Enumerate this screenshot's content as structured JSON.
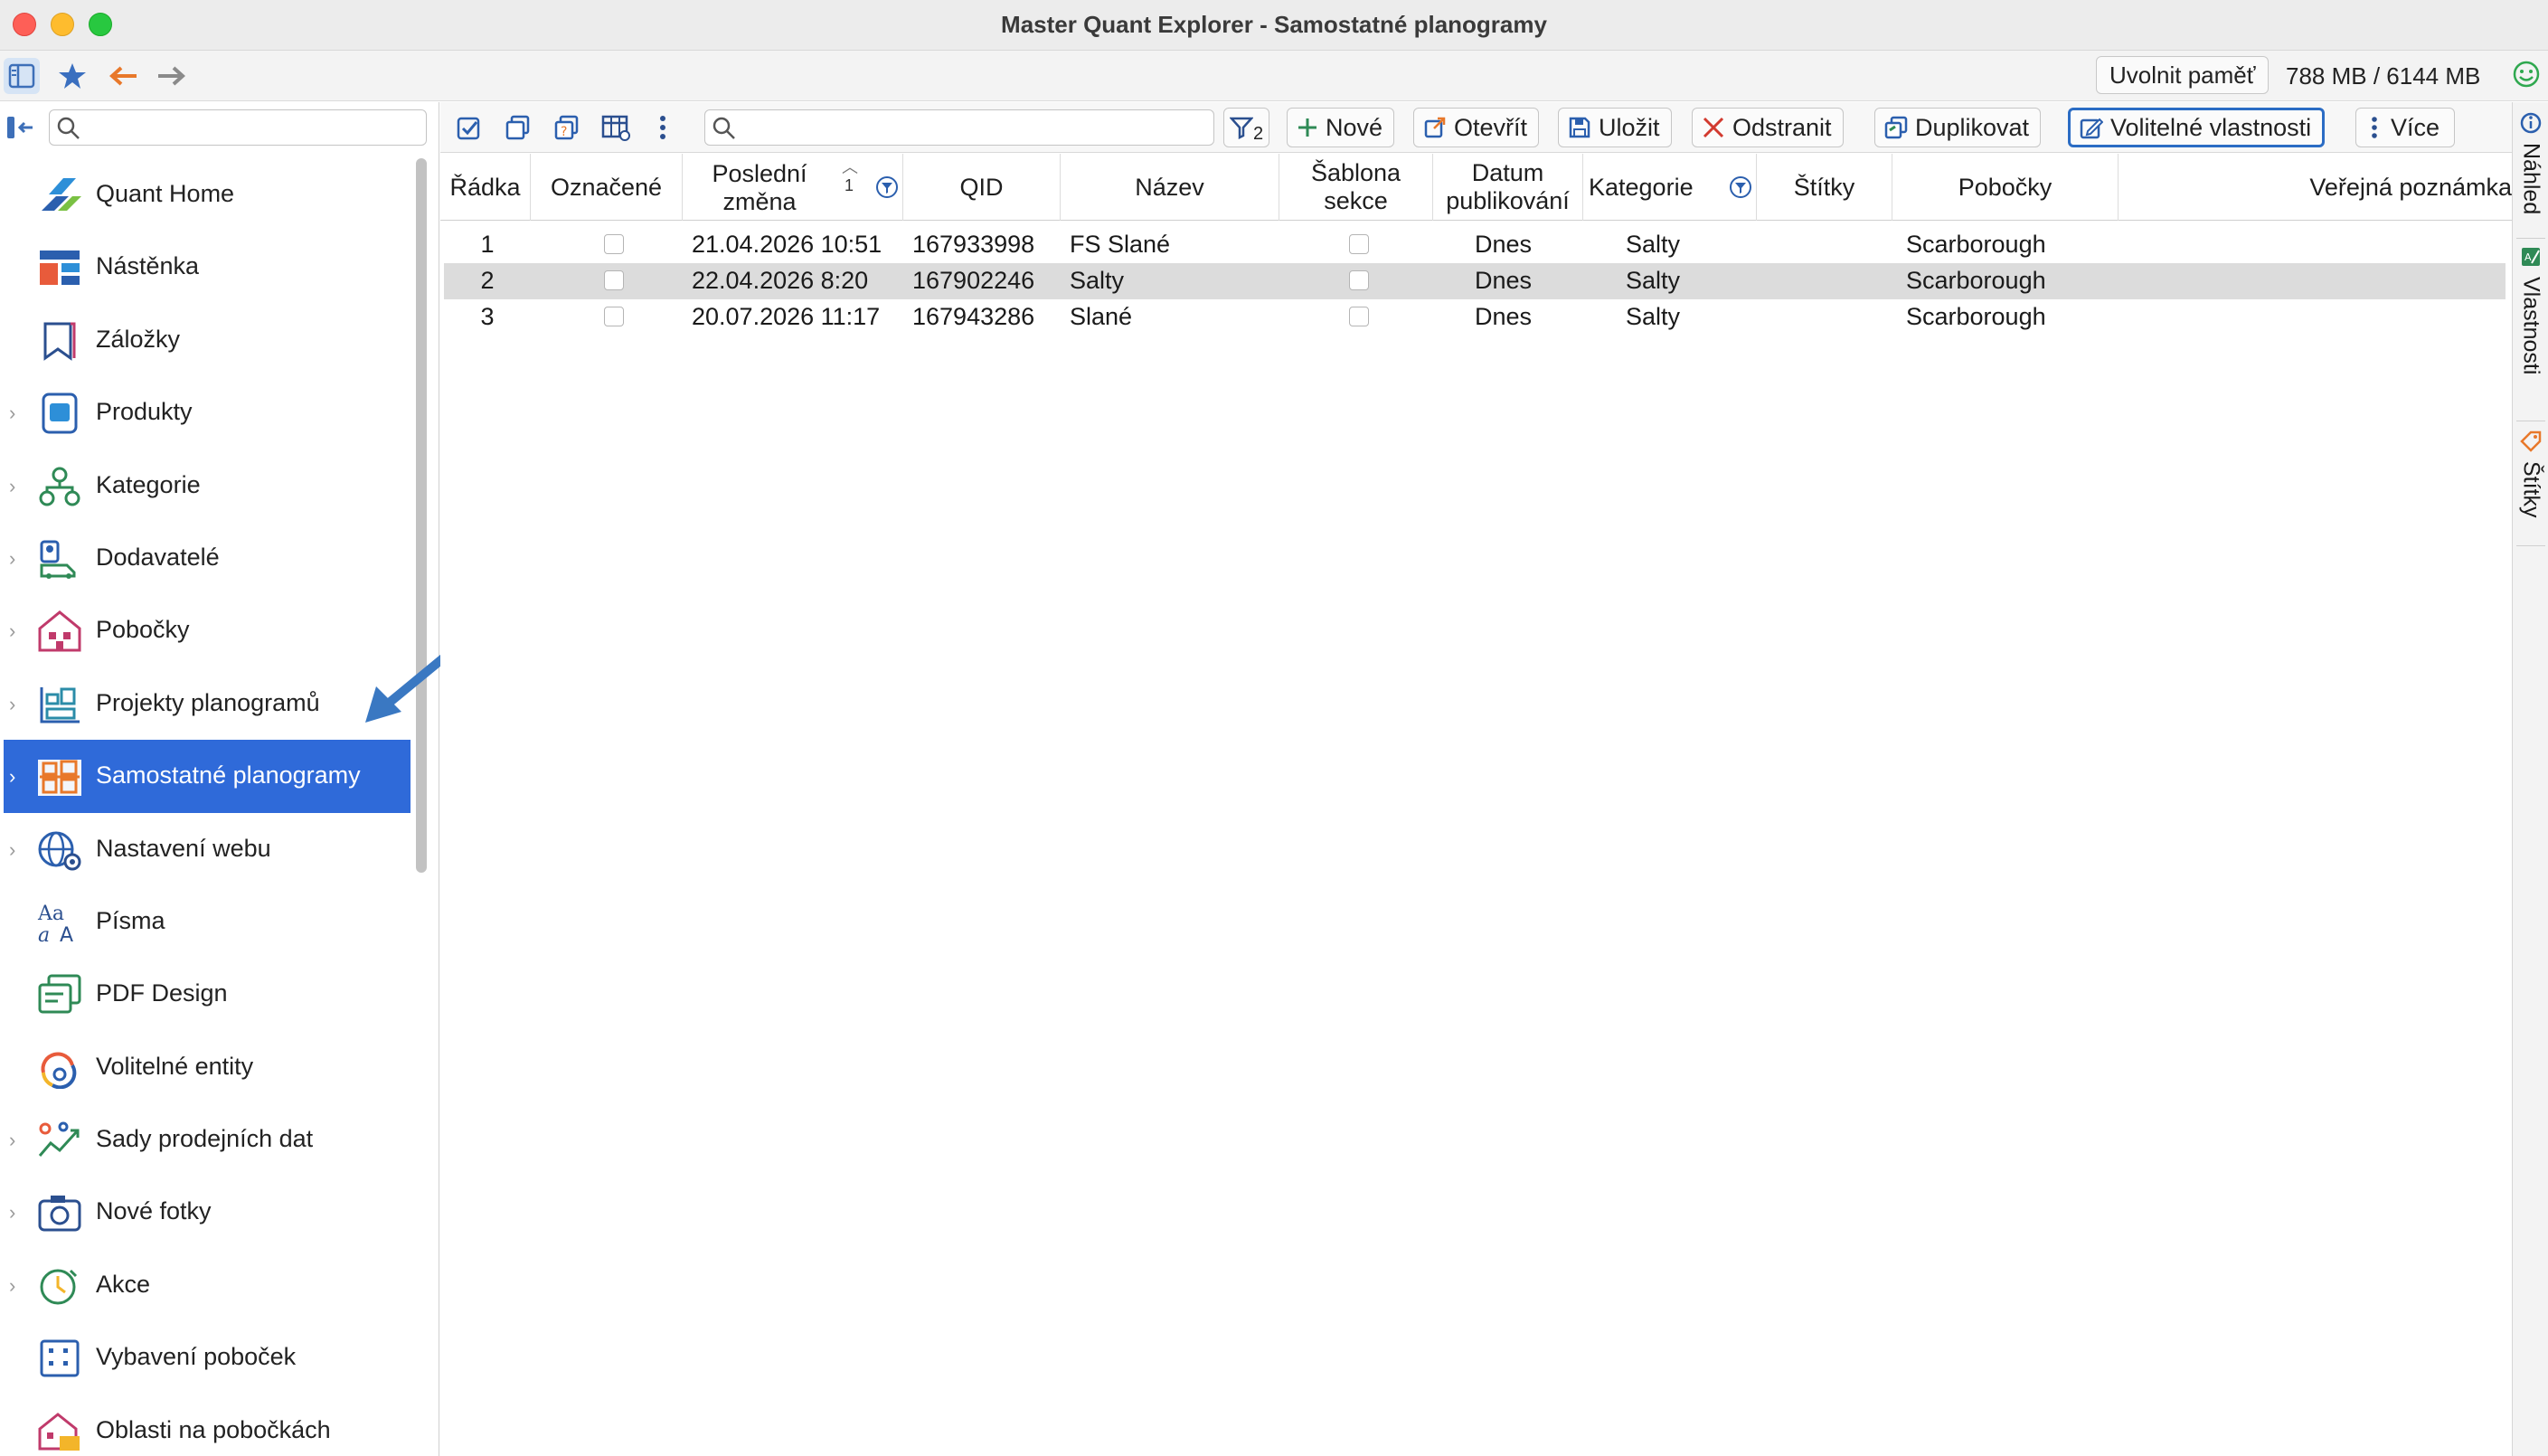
{
  "window": {
    "title": "Master Quant Explorer - Samostatné planogramy"
  },
  "globalbar": {
    "memory_button": "Uvolnit paměť",
    "memory_usage": "788 MB / 6144 MB"
  },
  "sidebar": {
    "search_placeholder": "",
    "items": [
      {
        "label": "Quant Home",
        "icon": "quant-home-icon",
        "expandable": false
      },
      {
        "label": "Nástěnka",
        "icon": "dashboard-icon",
        "expandable": false
      },
      {
        "label": "Záložky",
        "icon": "bookmark-icon",
        "expandable": false
      },
      {
        "label": "Produkty",
        "icon": "products-icon",
        "expandable": true
      },
      {
        "label": "Kategorie",
        "icon": "categories-icon",
        "expandable": true
      },
      {
        "label": "Dodavatelé",
        "icon": "suppliers-icon",
        "expandable": true
      },
      {
        "label": "Pobočky",
        "icon": "stores-icon",
        "expandable": true
      },
      {
        "label": "Projekty planogramů",
        "icon": "planogram-projects-icon",
        "expandable": true
      },
      {
        "label": "Samostatné planogramy",
        "icon": "standalone-planograms-icon",
        "expandable": true,
        "selected": true
      },
      {
        "label": "Nastavení webu",
        "icon": "web-settings-icon",
        "expandable": true
      },
      {
        "label": "Písma",
        "icon": "fonts-icon",
        "expandable": false
      },
      {
        "label": "PDF Design",
        "icon": "pdf-design-icon",
        "expandable": false
      },
      {
        "label": "Volitelné entity",
        "icon": "custom-entities-icon",
        "expandable": false
      },
      {
        "label": "Sady prodejních dat",
        "icon": "sales-data-icon",
        "expandable": true
      },
      {
        "label": "Nové fotky",
        "icon": "camera-icon",
        "expandable": true
      },
      {
        "label": "Akce",
        "icon": "promotions-icon",
        "expandable": true
      },
      {
        "label": "Vybavení poboček",
        "icon": "store-equipment-icon",
        "expandable": false
      },
      {
        "label": "Oblasti na pobočkách",
        "icon": "store-areas-icon",
        "expandable": false
      }
    ]
  },
  "toolbar": {
    "search_placeholder": "",
    "filter_badge": "2",
    "new_label": "Nové",
    "open_label": "Otevřít",
    "save_label": "Uložit",
    "delete_label": "Odstranit",
    "duplicate_label": "Duplikovat",
    "custom_props_label": "Volitelné vlastnosti",
    "more_label": "Více"
  },
  "table": {
    "headers": {
      "row": "Řádka",
      "marked": "Označené",
      "last_change_1": "Poslední",
      "last_change_2": "změna",
      "sort_index": "1",
      "qid": "QID",
      "name": "Název",
      "template_1": "Šablona",
      "template_2": "sekce",
      "published_1": "Datum",
      "published_2": "publikování",
      "category": "Kategorie",
      "tags": "Štítky",
      "stores": "Pobočky",
      "note": "Veřejná poznámka"
    },
    "rows": [
      {
        "row": "1",
        "last_change": "21.04.2026 10:51",
        "qid": "167933998",
        "name": "FS Slané",
        "published": "Dnes",
        "category": "Salty",
        "stores": "Scarborough"
      },
      {
        "row": "2",
        "last_change": "22.04.2026 8:20",
        "qid": "167902246",
        "name": "Salty",
        "published": "Dnes",
        "category": "Salty",
        "stores": "Scarborough"
      },
      {
        "row": "3",
        "last_change": "20.07.2026 11:17",
        "qid": "167943286",
        "name": "Slané",
        "published": "Dnes",
        "category": "Salty",
        "stores": "Scarborough"
      }
    ]
  },
  "rightbar": {
    "preview": "Náhled",
    "properties": "Vlastnosti",
    "tags": "Štítky"
  },
  "colors": {
    "accent": "#2f6ad9",
    "selected_row": "#dcdcdc",
    "annotation_arrow": "#3a78c2"
  }
}
